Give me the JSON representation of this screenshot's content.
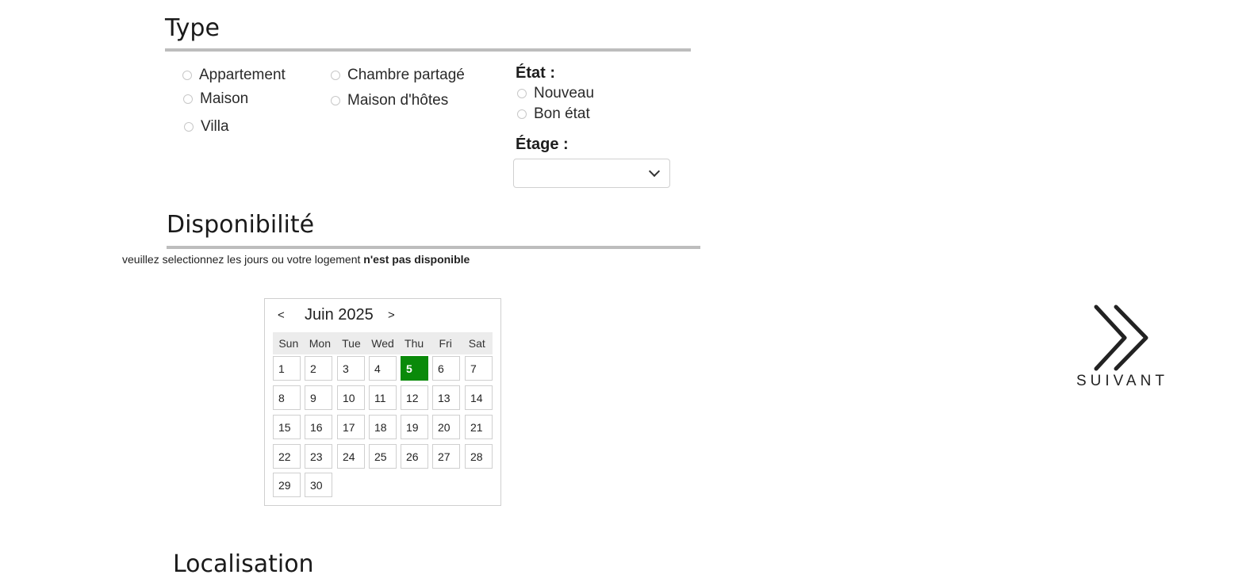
{
  "type_section": {
    "title": "Type",
    "options": [
      "Appartement",
      "Chambre partagé",
      "Maison",
      "Maison d'hôtes",
      "Villa"
    ]
  },
  "etat": {
    "label": "État :",
    "options": [
      "Nouveau",
      "Bon état"
    ]
  },
  "etage": {
    "label": "Étage :",
    "value": ""
  },
  "disponibilite": {
    "title": "Disponibilité",
    "note_prefix": "veuillez selectionnez les jours ou votre logement ",
    "note_bold": "n'est pas disponible"
  },
  "calendar": {
    "prev": "<",
    "next": ">",
    "month": "Juin 2025",
    "weekdays": [
      "Sun",
      "Mon",
      "Tue",
      "Wed",
      "Thu",
      "Fri",
      "Sat"
    ],
    "days": [
      "1",
      "2",
      "3",
      "4",
      "5",
      "6",
      "7",
      "8",
      "9",
      "10",
      "11",
      "12",
      "13",
      "14",
      "15",
      "16",
      "17",
      "18",
      "19",
      "20",
      "21",
      "22",
      "23",
      "24",
      "25",
      "26",
      "27",
      "28",
      "29",
      "30"
    ],
    "selected_day": "5",
    "selected_color": "#0a8a0a"
  },
  "localisation": {
    "title": "Localisation"
  },
  "next_button": {
    "label": "SUIVANT",
    "icon": "double-chevron-right-icon"
  }
}
